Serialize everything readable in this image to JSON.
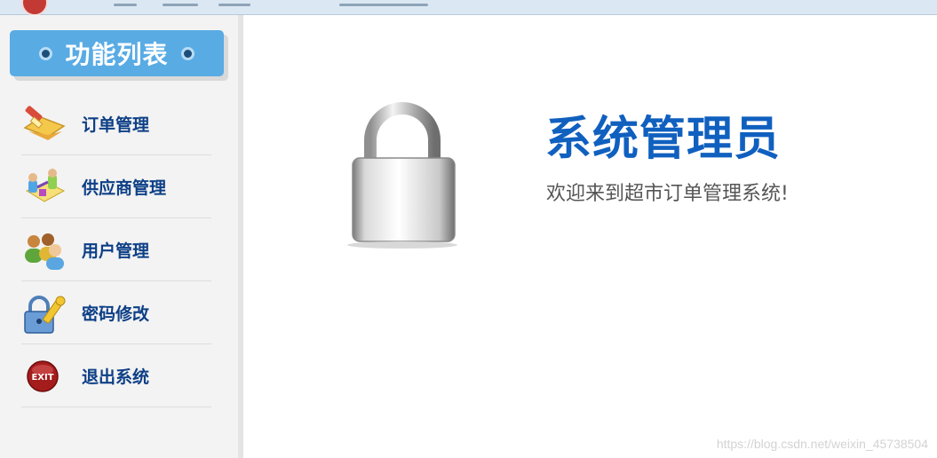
{
  "sidebar": {
    "title": "功能列表",
    "items": [
      {
        "label": "订单管理",
        "icon": "order-pencil-icon"
      },
      {
        "label": "供应商管理",
        "icon": "supplier-icon"
      },
      {
        "label": "用户管理",
        "icon": "users-icon"
      },
      {
        "label": "密码修改",
        "icon": "password-lock-icon"
      },
      {
        "label": "退出系统",
        "icon": "exit-icon"
      }
    ]
  },
  "main": {
    "role_title": "系统管理员",
    "welcome": "欢迎来到超市订单管理系统!",
    "lock_icon": "padlock-icon"
  },
  "watermark": "https://blog.csdn.net/weixin_45738504",
  "colors": {
    "accent": "#59abe4",
    "title_blue": "#1060bf",
    "menu_text": "#0d3f86"
  }
}
